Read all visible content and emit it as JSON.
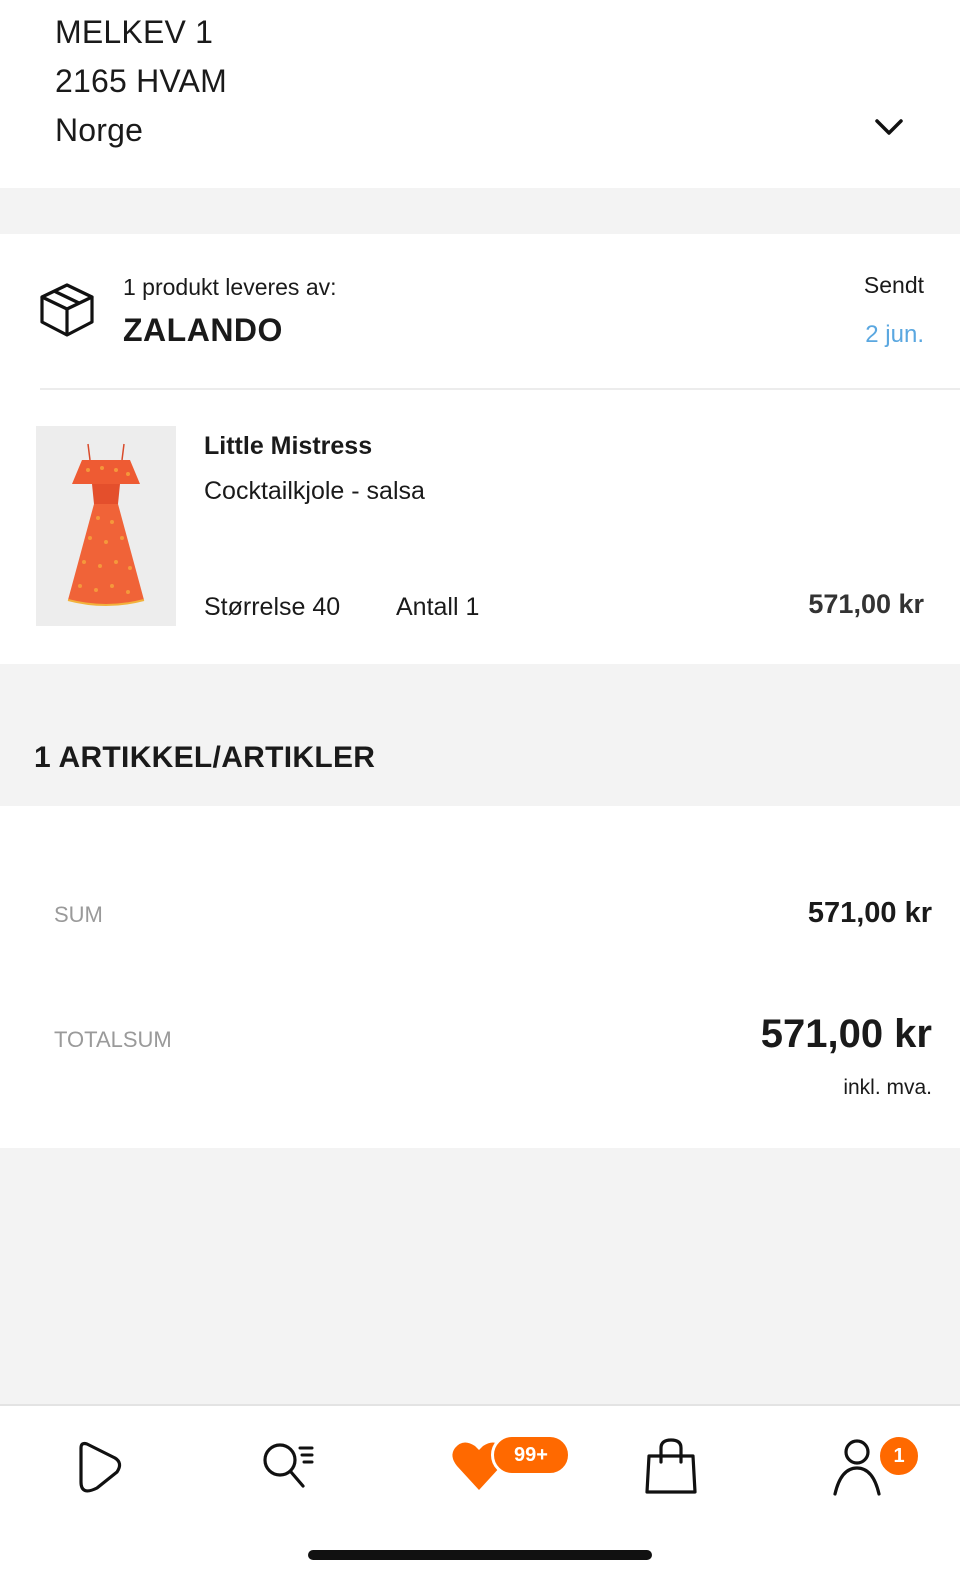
{
  "address": {
    "street": "MELKEV 1",
    "city": "2165 HVAM",
    "country": "Norge",
    "expand_icon": "chevron-down-icon"
  },
  "delivery": {
    "icon": "package-box-icon",
    "label": "1 produkt leveres av:",
    "seller": "ZALANDO",
    "status": "Sendt",
    "status_date": "2 jun.",
    "status_date_color": "#5aa7e0"
  },
  "product": {
    "image_icon": "dress-image",
    "brand": "Little Mistress",
    "name": "Cocktailkjole - salsa",
    "size": "Størrelse 40",
    "quantity": "Antall 1",
    "price": "571,00 kr"
  },
  "summary": {
    "title": "1 ARTIKKEL/ARTIKLER",
    "sum_label": "SUM",
    "sum_value": "571,00 kr",
    "total_label": "TOTALSUM",
    "total_value": "571,00 kr",
    "vat_note": "inkl. mva."
  },
  "tabbar": {
    "accent_color": "#ff6900",
    "tabs": [
      {
        "name": "home",
        "icon": "play-shape-icon"
      },
      {
        "name": "search",
        "icon": "search-icon"
      },
      {
        "name": "wishlist",
        "icon": "heart-icon",
        "badge": "99+"
      },
      {
        "name": "bag",
        "icon": "shopping-bag-icon"
      },
      {
        "name": "profile",
        "icon": "user-icon",
        "badge": "1"
      }
    ]
  }
}
